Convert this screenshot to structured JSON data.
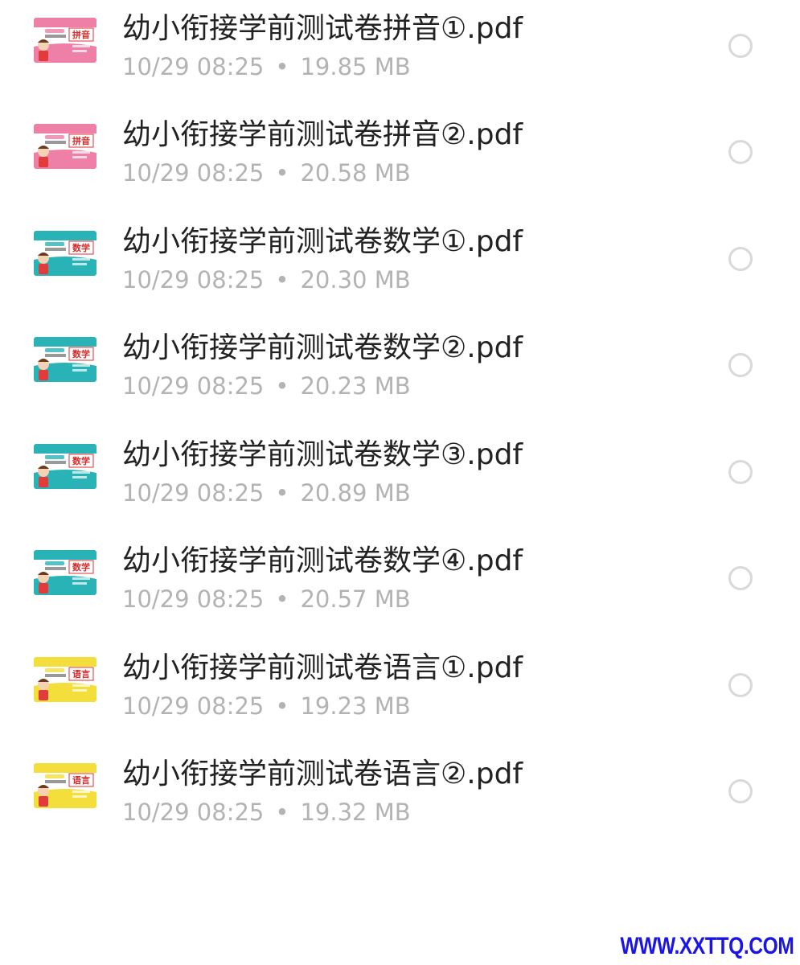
{
  "files": [
    {
      "name": "幼小衔接学前测试卷拼音①.pdf",
      "time": "10/29 08:25",
      "separator": "•",
      "size": "19.85 MB",
      "thumb_label": "拼音",
      "thumb_color": "#ee7fa6"
    },
    {
      "name": "幼小衔接学前测试卷拼音②.pdf",
      "time": "10/29 08:25",
      "separator": "•",
      "size": "20.58 MB",
      "thumb_label": "拼音",
      "thumb_color": "#ee7fa6"
    },
    {
      "name": "幼小衔接学前测试卷数学①.pdf",
      "time": "10/29 08:25",
      "separator": "•",
      "size": "20.30 MB",
      "thumb_label": "数学",
      "thumb_color": "#2ab3b6"
    },
    {
      "name": "幼小衔接学前测试卷数学②.pdf",
      "time": "10/29 08:25",
      "separator": "•",
      "size": "20.23 MB",
      "thumb_label": "数学",
      "thumb_color": "#2ab3b6"
    },
    {
      "name": "幼小衔接学前测试卷数学③.pdf",
      "time": "10/29 08:25",
      "separator": "•",
      "size": "20.89 MB",
      "thumb_label": "数学",
      "thumb_color": "#2ab3b6"
    },
    {
      "name": "幼小衔接学前测试卷数学④.pdf",
      "time": "10/29 08:25",
      "separator": "•",
      "size": "20.57 MB",
      "thumb_label": "数学",
      "thumb_color": "#2ab3b6"
    },
    {
      "name": "幼小衔接学前测试卷语言①.pdf",
      "time": "10/29 08:25",
      "separator": "•",
      "size": "19.23 MB",
      "thumb_label": "语言",
      "thumb_color": "#f3de3c"
    },
    {
      "name": "幼小衔接学前测试卷语言②.pdf",
      "time": "10/29 08:25",
      "separator": "•",
      "size": "19.32 MB",
      "thumb_label": "语言",
      "thumb_color": "#f3de3c"
    }
  ],
  "watermark": "WWW.XXTTQ.COM"
}
